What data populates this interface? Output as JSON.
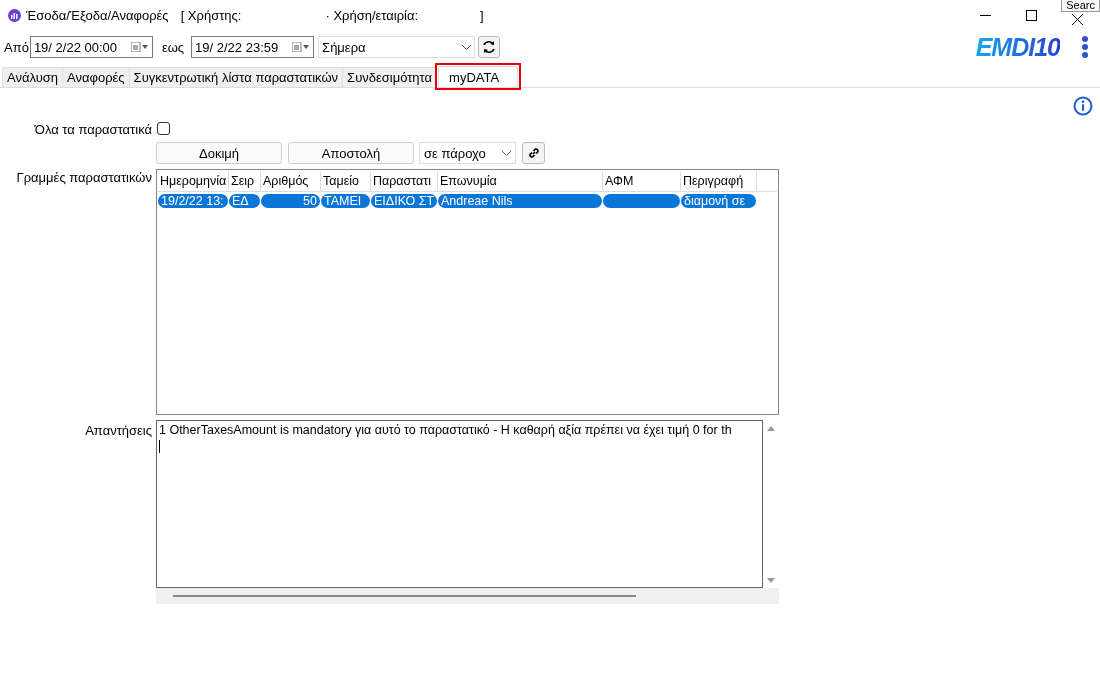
{
  "window": {
    "title": "Έσοδα/Έξοδα/Αναφορές",
    "user_label": "[ Χρήστης:",
    "company_label": "· Χρήση/εταιρία:",
    "closing_bracket": "]"
  },
  "tooltip": "Searc",
  "toolbar": {
    "from_label": "Από",
    "from_value": "19/  2/22 00:00",
    "to_label": "εως",
    "to_value": "19/  2/22 23:59",
    "period": "Σήμερα",
    "logo": "EMDI10"
  },
  "tabs": [
    {
      "label": "Ανάλυση",
      "selected": false,
      "highlighted": false
    },
    {
      "label": "Αναφορές",
      "selected": false,
      "highlighted": false
    },
    {
      "label": "Συγκεντρωτική λίστα παραστατικών",
      "selected": false,
      "highlighted": false
    },
    {
      "label": "Συνδεσιμότητα",
      "selected": false,
      "highlighted": false
    },
    {
      "label": "myDATA",
      "selected": true,
      "highlighted": true
    }
  ],
  "all_documents": {
    "label": "Όλα τα παραστατικά",
    "checked": false
  },
  "buttons": [
    "Δοκιμή",
    "Αποστολή"
  ],
  "provider": "σε πάροχο",
  "lines": {
    "label": "Γραμμές παραστατικών",
    "columns": [
      "Ημερομηνία",
      "Σειρ",
      "Αριθμός",
      "Ταμείο",
      "Παραστατι",
      "Επωνυμία",
      "ΑΦΜ",
      "Περιγραφή"
    ],
    "rows": [
      {
        "selected": true,
        "cells": [
          "19/2/22 13:",
          "ΕΔ",
          "50",
          "ΤΑΜΕΙ",
          "ΕΙΔΙΚΟ ΣΤ",
          "Andreae Nils",
          null,
          "διαμονή σε"
        ]
      }
    ]
  },
  "responses": {
    "label": "Απαντήσεις",
    "value": "1 OtherTaxesAmount is mandatory για αυτό το παραστατικό - Η καθαρή αξία πρέπει να έχει τιμή 0 for th"
  }
}
